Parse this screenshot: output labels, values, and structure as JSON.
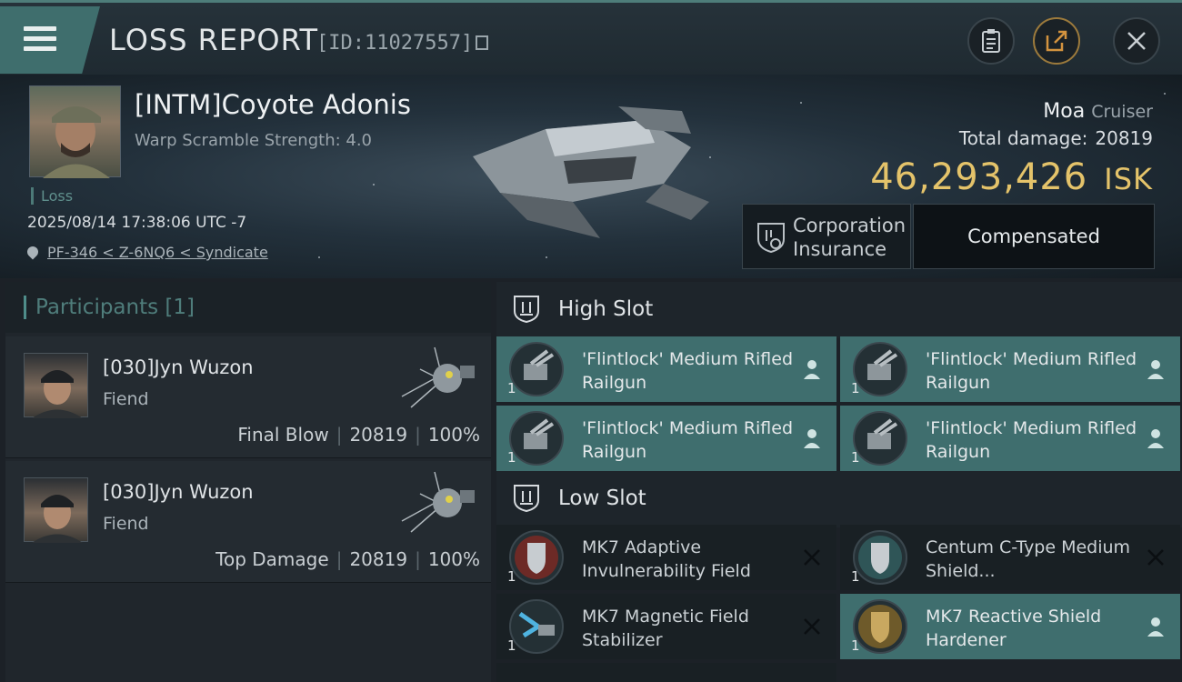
{
  "header": {
    "title": "LOSS REPORT",
    "report_id": "[ID:11027557]",
    "menu_icon": "hamburger-menu-icon",
    "buttons": [
      {
        "name": "clipboard-icon"
      },
      {
        "name": "share-icon",
        "accent": "#c58b3a"
      },
      {
        "name": "close-icon"
      }
    ]
  },
  "victim": {
    "name": "[INTM]Coyote Adonis",
    "warp_scramble": "Warp Scramble Strength: 4.0",
    "tag": "Loss",
    "datetime": "2025/08/14 17:38:06 UTC -7",
    "location": "PF-346 < Z-6NQ6 < Syndicate",
    "ship_name": "Moa",
    "ship_class": "Cruiser",
    "total_damage_label": "Total damage:",
    "total_damage": "20819",
    "isk_value": "46,293,426",
    "isk_unit": "ISK",
    "insurance_label": "Corporation Insurance",
    "insurance_status": "Compensated"
  },
  "participants": {
    "title": "Participants",
    "count": "[1]",
    "rows": [
      {
        "name": "[030]Jyn Wuzon",
        "ship": "Fiend",
        "role": "Final Blow",
        "damage": "20819",
        "percent": "100%"
      },
      {
        "name": "[030]Jyn Wuzon",
        "ship": "Fiend",
        "role": "Top Damage",
        "damage": "20819",
        "percent": "100%"
      }
    ]
  },
  "fitting": {
    "high_slot_label": "High Slot",
    "low_slot_label": "Low Slot",
    "high_slot": [
      {
        "name": "'Flintlock' Medium Rifled Railgun",
        "qty": "1",
        "status": "person-icon"
      },
      {
        "name": "'Flintlock' Medium Rifled Railgun",
        "qty": "1",
        "status": "person-icon"
      },
      {
        "name": "'Flintlock' Medium Rifled Railgun",
        "qty": "1",
        "status": "person-icon"
      },
      {
        "name": "'Flintlock' Medium Rifled Railgun",
        "qty": "1",
        "status": "person-icon"
      }
    ],
    "low_slot": [
      {
        "name": "MK7 Adaptive Invulnerability Field",
        "qty": "1",
        "status": "destroyed-x-icon"
      },
      {
        "name": "Centum C-Type Medium Shield...",
        "qty": "1",
        "status": "destroyed-x-icon"
      },
      {
        "name": "MK7 Magnetic Field Stabilizer",
        "qty": "1",
        "status": "destroyed-x-icon"
      },
      {
        "name": "MK7 Reactive Shield Hardener",
        "qty": "1",
        "status": "person-icon"
      }
    ]
  },
  "colors": {
    "accent_teal": "#3f6e6e",
    "isk_gold": "#e4c36a"
  }
}
